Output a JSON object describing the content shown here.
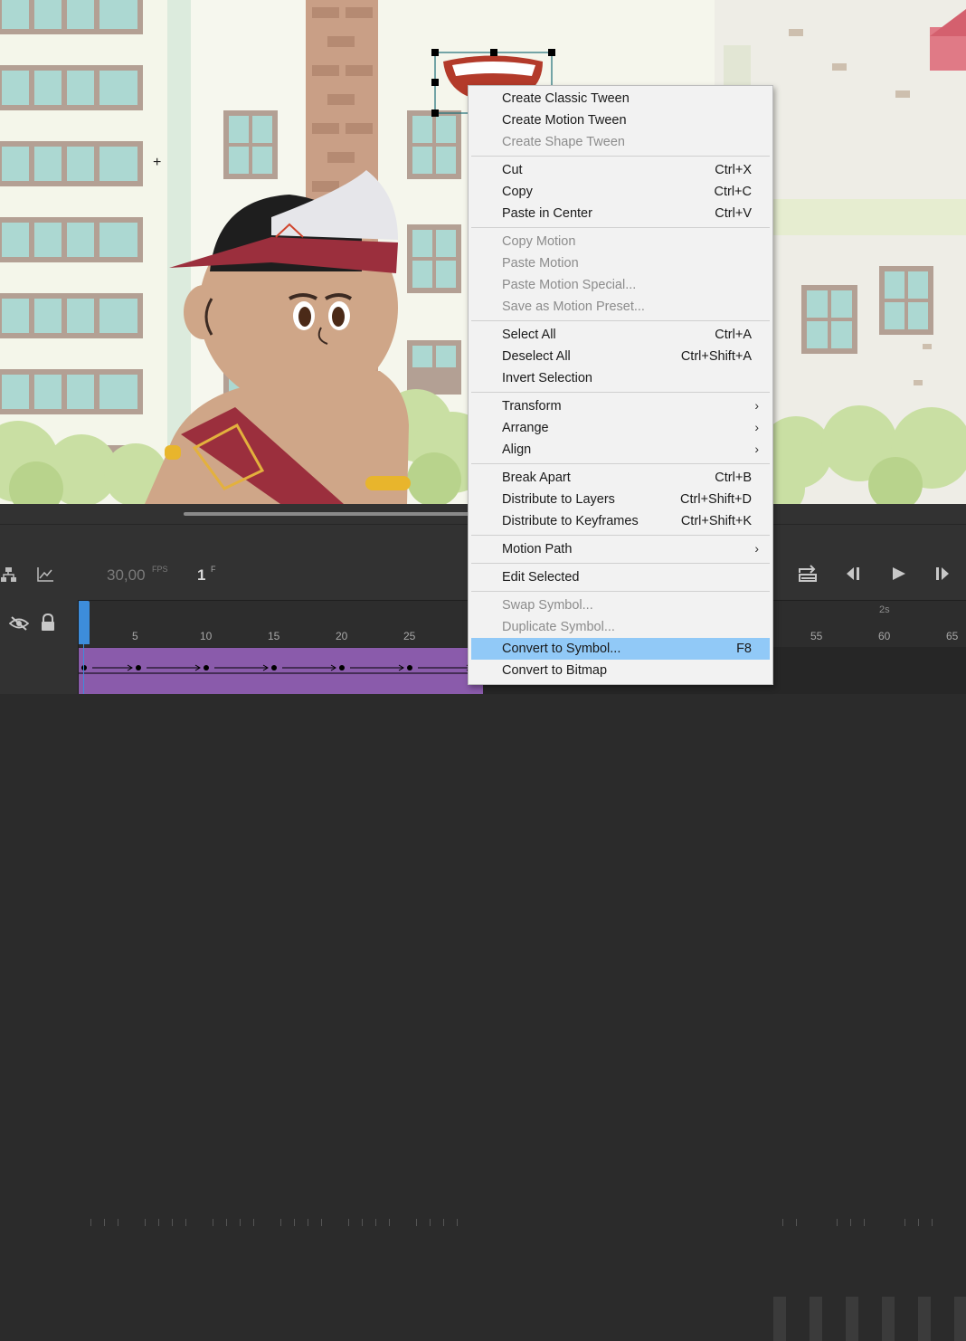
{
  "timeline": {
    "fps_value": "30,00",
    "fps_unit": "FPS",
    "frame_value": "1",
    "frame_unit": "F",
    "time_marker": "2s",
    "frame_numbers": [
      "5",
      "10",
      "15",
      "20",
      "25",
      "55",
      "60",
      "65"
    ]
  },
  "context_menu": {
    "items": [
      {
        "label": "Create Classic Tween",
        "shortcut": "",
        "enabled": true
      },
      {
        "label": "Create Motion Tween",
        "shortcut": "",
        "enabled": true
      },
      {
        "label": "Create Shape Tween",
        "shortcut": "",
        "enabled": false
      },
      {
        "label": "Cut",
        "shortcut": "Ctrl+X",
        "enabled": true
      },
      {
        "label": "Copy",
        "shortcut": "Ctrl+C",
        "enabled": true
      },
      {
        "label": "Paste in Center",
        "shortcut": "Ctrl+V",
        "enabled": true
      },
      {
        "label": "Copy Motion",
        "shortcut": "",
        "enabled": false
      },
      {
        "label": "Paste Motion",
        "shortcut": "",
        "enabled": false
      },
      {
        "label": "Paste Motion Special...",
        "shortcut": "",
        "enabled": false
      },
      {
        "label": "Save as Motion Preset...",
        "shortcut": "",
        "enabled": false
      },
      {
        "label": "Select All",
        "shortcut": "Ctrl+A",
        "enabled": true
      },
      {
        "label": "Deselect All",
        "shortcut": "Ctrl+Shift+A",
        "enabled": true
      },
      {
        "label": "Invert Selection",
        "shortcut": "",
        "enabled": true
      },
      {
        "label": "Transform",
        "shortcut": "",
        "enabled": true,
        "submenu": true
      },
      {
        "label": "Arrange",
        "shortcut": "",
        "enabled": true,
        "submenu": true
      },
      {
        "label": "Align",
        "shortcut": "",
        "enabled": true,
        "submenu": true
      },
      {
        "label": "Break Apart",
        "shortcut": "Ctrl+B",
        "enabled": true
      },
      {
        "label": "Distribute to Layers",
        "shortcut": "Ctrl+Shift+D",
        "enabled": true
      },
      {
        "label": "Distribute to Keyframes",
        "shortcut": "Ctrl+Shift+K",
        "enabled": true
      },
      {
        "label": "Motion Path",
        "shortcut": "",
        "enabled": true,
        "submenu": true
      },
      {
        "label": "Edit Selected",
        "shortcut": "",
        "enabled": true
      },
      {
        "label": "Swap Symbol...",
        "shortcut": "",
        "enabled": false
      },
      {
        "label": "Duplicate Symbol...",
        "shortcut": "",
        "enabled": false
      },
      {
        "label": "Convert to Symbol...",
        "shortcut": "F8",
        "enabled": true,
        "highlighted": true
      },
      {
        "label": "Convert to Bitmap",
        "shortcut": "",
        "enabled": true
      }
    ],
    "submenu_arrow": "›"
  },
  "colors": {
    "highlight": "#91c9f7",
    "tween_span": "#8a5bab",
    "playhead": "#3d8ddb"
  },
  "icons": [
    "crosshair-cursor-icon",
    "layer-hierarchy-icon",
    "graph-icon",
    "loop-icon",
    "step-back-icon",
    "play-icon",
    "step-forward-icon",
    "visibility-off-icon",
    "lock-icon"
  ]
}
